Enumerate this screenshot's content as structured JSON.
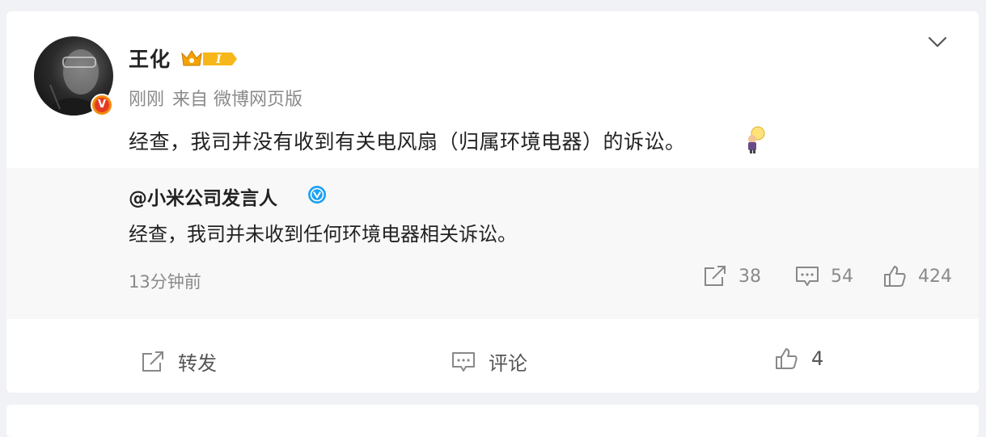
{
  "post": {
    "username": "王化",
    "level_badge": "I",
    "time": "刚刚",
    "source": "来自 微博网页版",
    "text": "经查，我司并没有收到有关电风扇（归属环境电器）的诉讼。",
    "avatar_badge": "V"
  },
  "repost": {
    "author": "@小米公司发言人",
    "verified_badge": "V",
    "text": "经查，我司并未收到任何环境电器相关诉讼。",
    "time": "13分钟前",
    "shares": "38",
    "comments": "54",
    "likes": "424"
  },
  "actions": {
    "repost_label": "转发",
    "comment_label": "评论",
    "like_count": "4"
  },
  "colors": {
    "page_bg": "#f1f2f5",
    "repost_bg": "#f8f8f8",
    "accent_orange": "#f38b0e",
    "verified_blue": "#1da1f2"
  },
  "icons": [
    "chevron-down-icon",
    "crown-level-icon",
    "vip-v-icon",
    "verified-icon",
    "share-icon",
    "comment-icon",
    "like-icon",
    "lightbulb-emoji-icon"
  ]
}
